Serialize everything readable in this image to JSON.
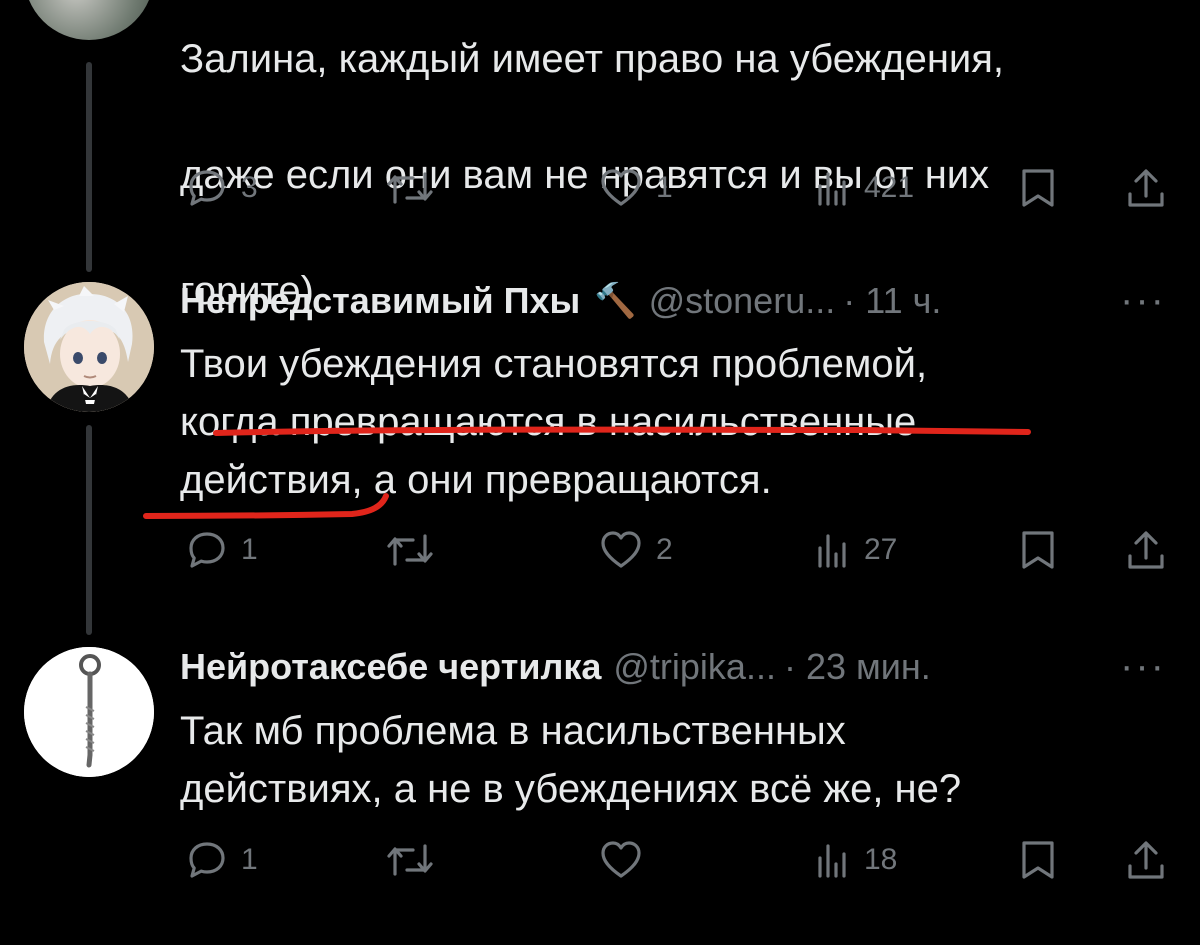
{
  "tweet1": {
    "text_lines": [
      "Залина, каждый имеет право на убеждения,",
      "даже если они вам не нравятся и вы от них",
      "горите)"
    ],
    "replies": "3",
    "likes": "1",
    "views": "421"
  },
  "tweet2": {
    "name": "Непредставимый Пхы",
    "name_emoji": "🔨",
    "handle": "@stoneru...",
    "time": "· 11 ч.",
    "text": "Твои убеждения становятся проблемой,\nкогда превращаются в насильственные\nдействия, а они превращаются.",
    "replies": "1",
    "likes": "2",
    "views": "27"
  },
  "tweet3": {
    "name": "Нейротаксебе чертилка",
    "handle": "@tripika...",
    "time": "· 23 мин.",
    "text": "Так мб проблема в насильственных\nдействиях, а не в убеждениях всё же, не?",
    "replies": "1",
    "likes": "",
    "views": "18"
  },
  "more_label": "···",
  "colors": {
    "background": "#000000",
    "text": "#e7e9ea",
    "muted": "#71767b",
    "annotation": "#e0251b"
  },
  "icons": [
    "reply-icon",
    "retweet-icon",
    "like-icon",
    "views-icon",
    "bookmark-icon",
    "share-icon"
  ]
}
